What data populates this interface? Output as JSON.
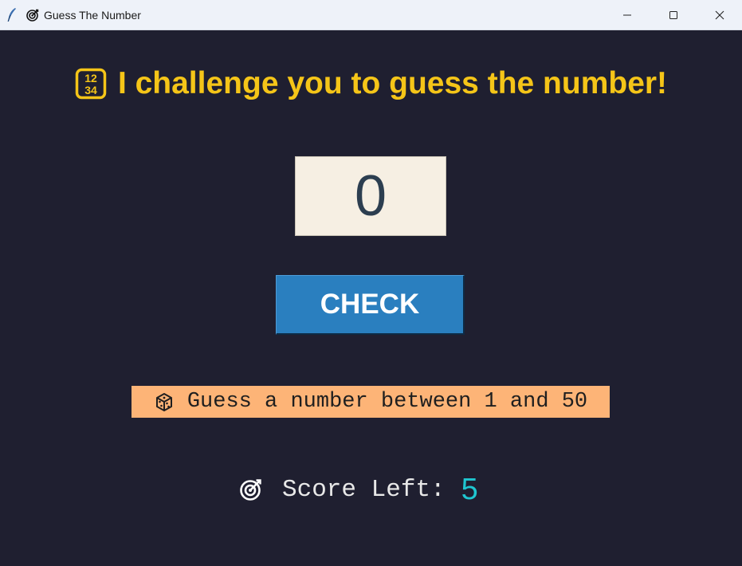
{
  "window": {
    "title": "Guess The Number",
    "controls": [
      "minimize",
      "maximize",
      "close"
    ]
  },
  "game": {
    "heading": "I challenge you to guess the number!",
    "heading_icon": "input-numbers-icon",
    "guess_value": "0",
    "check_label": "CHECK",
    "hint_icon": "dice-icon",
    "hint": "Guess a number between 1 and 50",
    "score_icon": "direct-hit-icon",
    "score_label": "Score Left:",
    "score_value": "5"
  },
  "colors": {
    "background": "#1f1f30",
    "heading": "#f5c518",
    "entry_bg": "#f6efe3",
    "entry_text": "#2c3e50",
    "button": "#2a7fbf",
    "hint_bg": "#fdb477",
    "score_value": "#1fc6d0"
  }
}
